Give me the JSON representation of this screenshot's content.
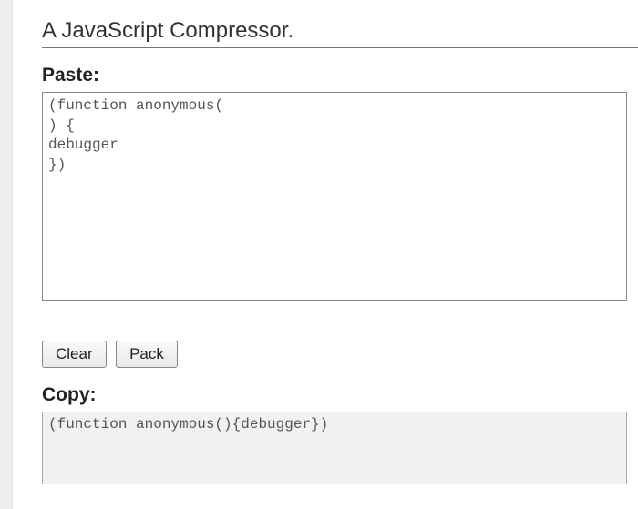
{
  "header": {
    "title": "A JavaScript Compressor."
  },
  "paste": {
    "label": "Paste:",
    "value": "(function anonymous(\n) {\ndebugger\n})"
  },
  "buttons": {
    "clear": "Clear",
    "pack": "Pack"
  },
  "copy": {
    "label": "Copy:",
    "value": "(function anonymous(){debugger})"
  }
}
